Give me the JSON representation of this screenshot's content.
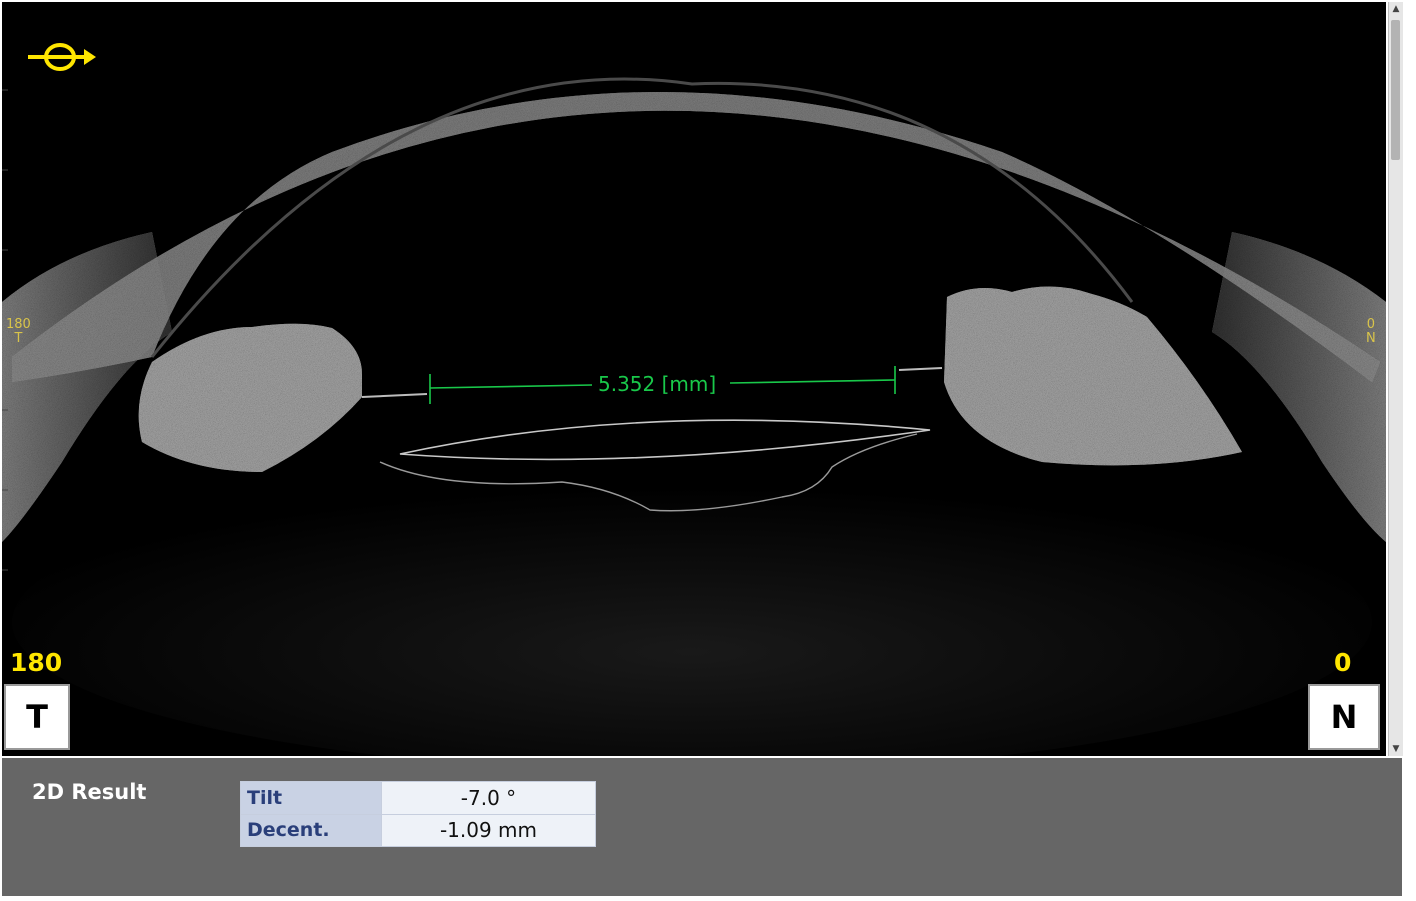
{
  "scan": {
    "measurement_label": "5.352 [mm]",
    "left_side": {
      "angle": "180",
      "label": "T",
      "small_angle": "180",
      "small_letter": "T"
    },
    "right_side": {
      "angle": "0",
      "label": "N",
      "small_angle": "0",
      "small_letter": "N"
    },
    "direction_icon": "eye-direction-icon",
    "colors": {
      "angle_text": "#ffe600",
      "measurement": "#19c84a",
      "background": "#000000"
    }
  },
  "result": {
    "title": "2D Result",
    "rows": [
      {
        "label": "Tilt",
        "value": "-7.0 °"
      },
      {
        "label": "Decent.",
        "value": "-1.09 mm"
      }
    ]
  }
}
